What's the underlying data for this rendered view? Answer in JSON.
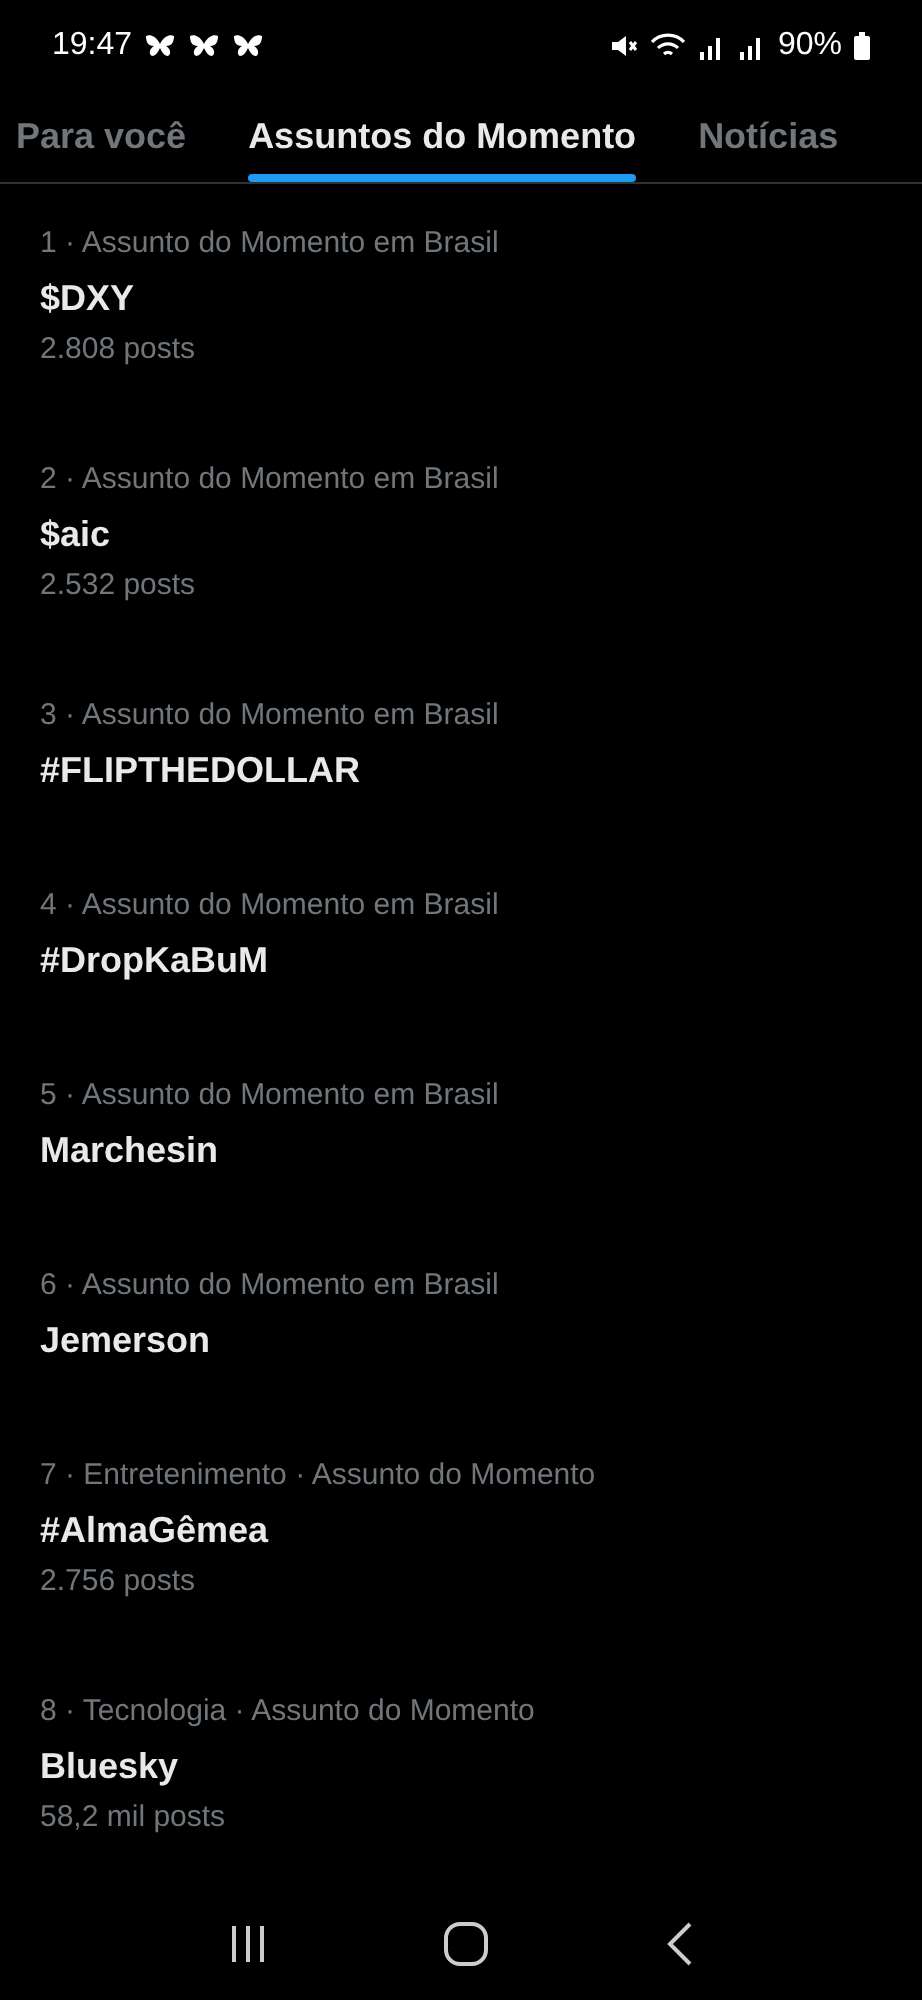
{
  "status_bar": {
    "time": "19:47",
    "battery": "90%"
  },
  "tabs": [
    {
      "label": "Para você",
      "selected": false
    },
    {
      "label": "Assuntos do Momento",
      "selected": true
    },
    {
      "label": "Notícias",
      "selected": false
    }
  ],
  "trends": [
    {
      "meta": "1 · Assunto do Momento em Brasil",
      "title": "$DXY",
      "posts": "2.808 posts"
    },
    {
      "meta": "2 · Assunto do Momento em Brasil",
      "title": "$aic",
      "posts": "2.532 posts"
    },
    {
      "meta": "3 · Assunto do Momento em Brasil",
      "title": "#FLIPTHEDOLLAR"
    },
    {
      "meta": "4 · Assunto do Momento em Brasil",
      "title": "#DropKaBuM"
    },
    {
      "meta": "5 · Assunto do Momento em Brasil",
      "title": "Marchesin"
    },
    {
      "meta": "6 · Assunto do Momento em Brasil",
      "title": "Jemerson"
    },
    {
      "meta": "7 · Entretenimento · Assunto do Momento",
      "title": "#AlmaGêmea",
      "posts": "2.756 posts"
    },
    {
      "meta": "8 · Tecnologia · Assunto do Momento",
      "title": "Bluesky",
      "posts": "58,2 mil posts"
    }
  ]
}
